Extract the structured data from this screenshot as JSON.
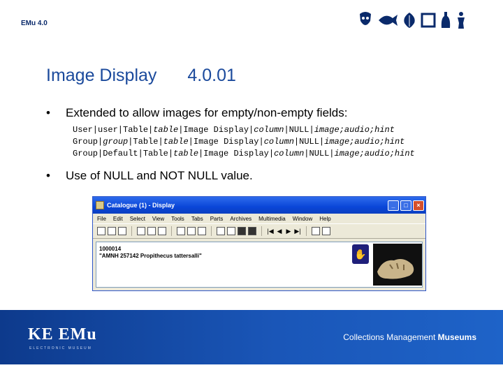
{
  "header": {
    "label": "EMu 4.0",
    "icons": [
      "african-mask-icon",
      "fish-icon",
      "leaf-icon",
      "picture-frame-icon",
      "bottle-icon",
      "figure-icon"
    ]
  },
  "slide": {
    "title": "Image Display",
    "version": "4.0.01",
    "bullet1": "Extended to allow images for empty/non-empty fields:",
    "code_lines": [
      {
        "a": "User|user|Table|",
        "b": "table",
        "c": "|Image Display|",
        "d": "column",
        "e": "|NULL|",
        "f": "image;audio;hint"
      },
      {
        "a": "Group|",
        "b": "group",
        "c": "|Table|",
        "d": "table",
        "e": "|Image Display|",
        "f": "column",
        "g": "|NULL|",
        "h": "image;audio;hint"
      },
      {
        "a": "Group|Default|Table|",
        "b": "table",
        "c": "|Image Display|",
        "d": "column",
        "e": "|NULL|",
        "f": "image;audio;hint"
      }
    ],
    "bullet2": "Use of NULL and NOT NULL value."
  },
  "window": {
    "title": "Catalogue (1) - Display",
    "menu": [
      "File",
      "Edit",
      "Select",
      "View",
      "Tools",
      "Tabs",
      "Parts",
      "Archives",
      "Multimedia",
      "Window",
      "Help"
    ],
    "record_line1": "1000014",
    "record_line2": "\"AMNH 257142 Propithecus tattersalli\""
  },
  "footer": {
    "logo": "KE EMu",
    "logo_sub": "ELECTRONIC MUSEUM",
    "tagline_normal": "Collections Management ",
    "tagline_bold": "Museums"
  },
  "colors": {
    "title": "#1b4a9c",
    "footer": "#1a56b8",
    "window_title": "#0a46d8"
  }
}
